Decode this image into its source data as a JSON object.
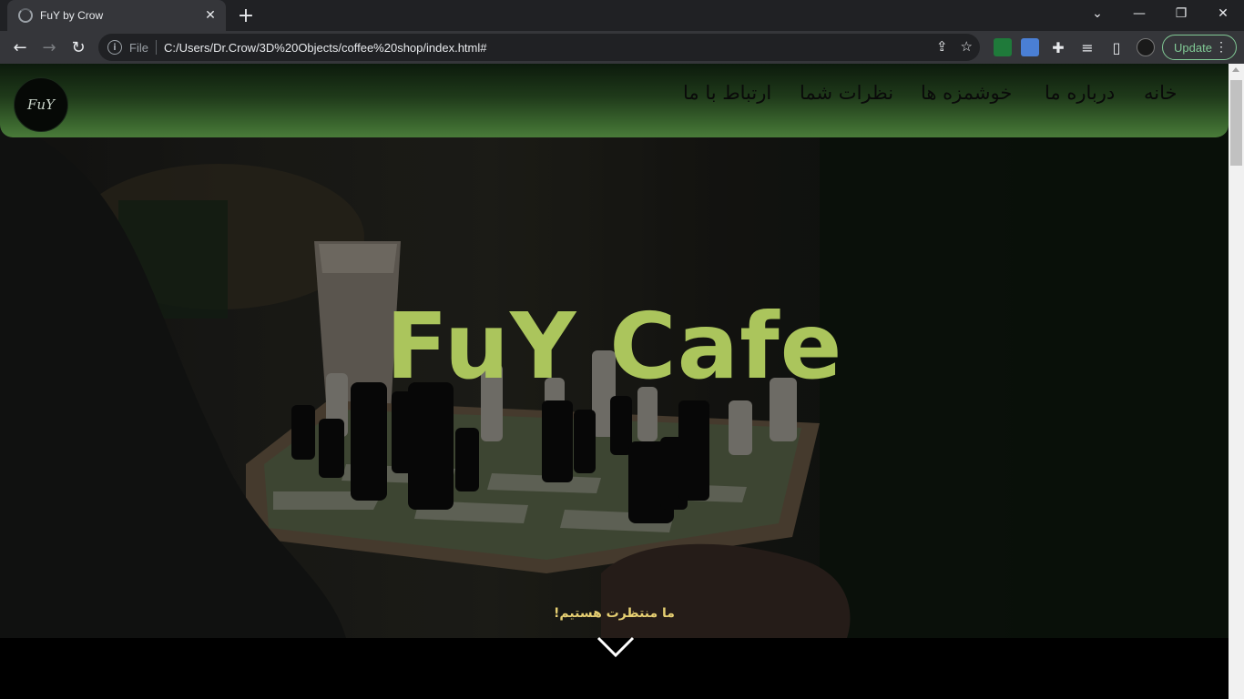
{
  "browser": {
    "tab_title": "FuY by Crow",
    "address_scheme": "File",
    "address_url": "C:/Users/Dr.Crow/3D%20Objects/coffee%20shop/index.html#",
    "update_label": "Update"
  },
  "site": {
    "logo_text": "FuY",
    "nav_items": [
      "خانه",
      "درباره ما",
      "خوشمزه ها",
      "نظرات شما",
      "ارتباط با ما"
    ],
    "hero_title": "FuY Cafe",
    "wait_text": "ما منتظرت هستیم!"
  },
  "colors": {
    "hero_title": "#abc55c",
    "wait_text": "#e6cf72",
    "navbar_bottom": "#4a7b3a",
    "update_accent": "#81c995"
  }
}
